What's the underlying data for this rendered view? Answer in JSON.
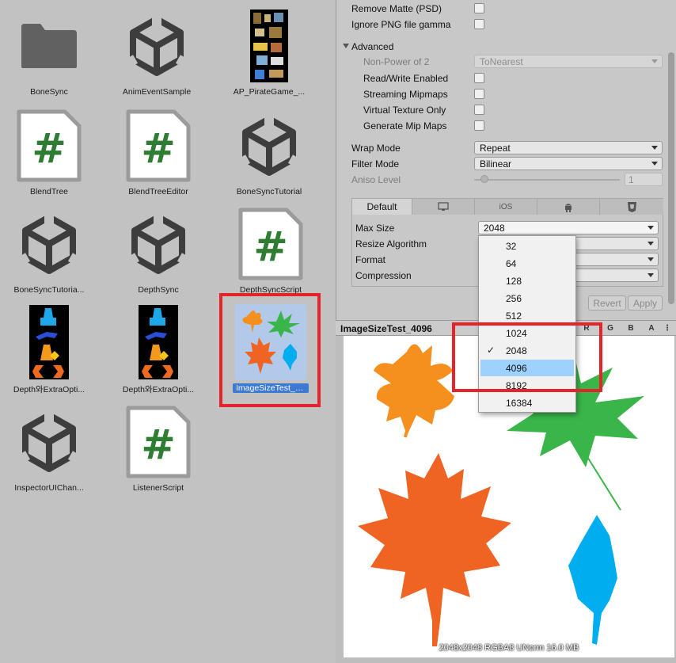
{
  "project": {
    "assets": [
      {
        "name": "BoneSync",
        "kind": "folder"
      },
      {
        "name": "AnimEventSample",
        "kind": "unity"
      },
      {
        "name": "AP_PirateGame_...",
        "kind": "sprite-sheet"
      },
      {
        "name": "BlendTree",
        "kind": "script"
      },
      {
        "name": "BlendTreeEditor",
        "kind": "script"
      },
      {
        "name": "BoneSyncTutorial",
        "kind": "unity"
      },
      {
        "name": "BoneSyncTutoria...",
        "kind": "unity"
      },
      {
        "name": "DepthSync",
        "kind": "unity"
      },
      {
        "name": "DepthSyncScript",
        "kind": "script"
      },
      {
        "name": "Depth와ExtraOpti...",
        "kind": "sprite"
      },
      {
        "name": "Depth와ExtraOpti...",
        "kind": "sprite"
      },
      {
        "name": "ImageSizeTest_4...",
        "kind": "leaves",
        "selected": true
      },
      {
        "name": "InspectorUIChan...",
        "kind": "unity"
      },
      {
        "name": "ListenerScript",
        "kind": "script"
      }
    ],
    "script_glyph": "#"
  },
  "inspector": {
    "remove_matte": "Remove Matte (PSD)",
    "ignore_gamma": "Ignore PNG file gamma",
    "advanced": "Advanced",
    "npot_label": "Non-Power of 2",
    "npot_value": "ToNearest",
    "read_write": "Read/Write Enabled",
    "streaming_mips": "Streaming Mipmaps",
    "virtual_texture": "Virtual Texture Only",
    "gen_mips": "Generate Mip Maps",
    "wrap_label": "Wrap Mode",
    "wrap_value": "Repeat",
    "filter_label": "Filter Mode",
    "filter_value": "Bilinear",
    "aniso_label": "Aniso Level",
    "aniso_value": "1",
    "tabs": {
      "default": "Default",
      "ios": "iOS"
    },
    "max_size_label": "Max Size",
    "max_size_value": "2048",
    "resize_label": "Resize Algorithm",
    "format_label": "Format",
    "compression_label": "Compression",
    "revert": "Revert",
    "apply": "Apply"
  },
  "size_options": [
    "32",
    "64",
    "128",
    "256",
    "512",
    "1024",
    "2048",
    "4096",
    "8192",
    "16384"
  ],
  "size_selected": "2048",
  "size_hover": "4096",
  "preview": {
    "title": "ImageSizeTest_4096",
    "channels": [
      "R",
      "G",
      "B",
      "A"
    ],
    "info": "2048x2048  RGBA8 UNorm   16.0 MB"
  },
  "colors": {
    "highlight": "#e4232a",
    "leaf_orange": "#f5901e",
    "leaf_green": "#3ab54a",
    "leaf_red_orange": "#ef6423",
    "leaf_blue": "#00aeef",
    "script_green": "#2e7d32"
  }
}
